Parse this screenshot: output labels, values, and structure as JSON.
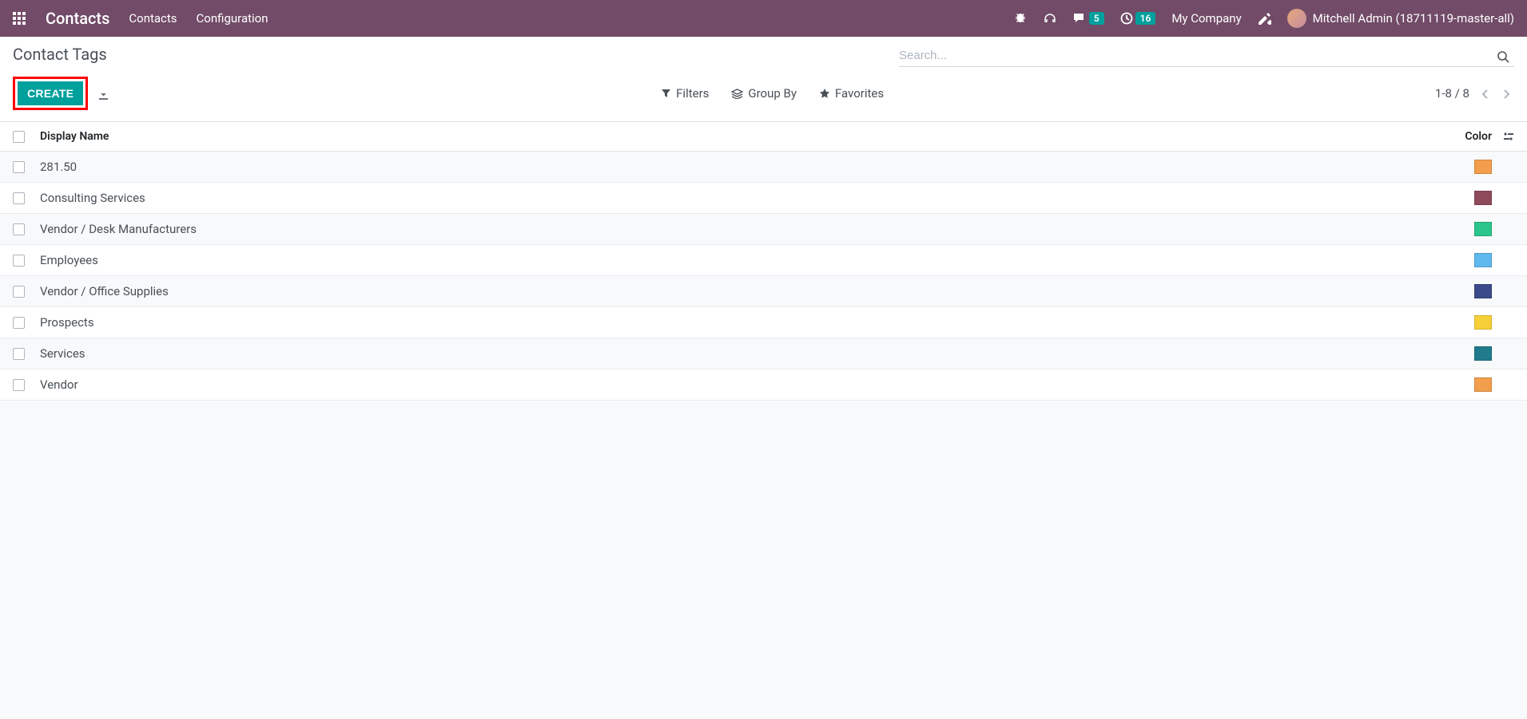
{
  "navbar": {
    "app_name": "Contacts",
    "menu": [
      "Contacts",
      "Configuration"
    ],
    "messages_badge": "5",
    "activities_badge": "16",
    "company": "My Company",
    "user": "Mitchell Admin (18711119-master-all)"
  },
  "control": {
    "page_title": "Contact Tags",
    "search_placeholder": "Search...",
    "create_label": "CREATE",
    "filters_label": "Filters",
    "groupby_label": "Group By",
    "favorites_label": "Favorites",
    "pager": "1-8 / 8"
  },
  "table": {
    "header_name": "Display Name",
    "header_color": "Color",
    "rows": [
      {
        "name": "281.50",
        "color": "#f29e4c"
      },
      {
        "name": "Consulting Services",
        "color": "#8e4a5b"
      },
      {
        "name": "Vendor / Desk Manufacturers",
        "color": "#2bc48a"
      },
      {
        "name": "Employees",
        "color": "#5fb8ee"
      },
      {
        "name": "Vendor / Office Supplies",
        "color": "#3a4a8a"
      },
      {
        "name": "Prospects",
        "color": "#f7d038"
      },
      {
        "name": "Services",
        "color": "#1f7a8c"
      },
      {
        "name": "Vendor",
        "color": "#f29e4c"
      }
    ]
  }
}
